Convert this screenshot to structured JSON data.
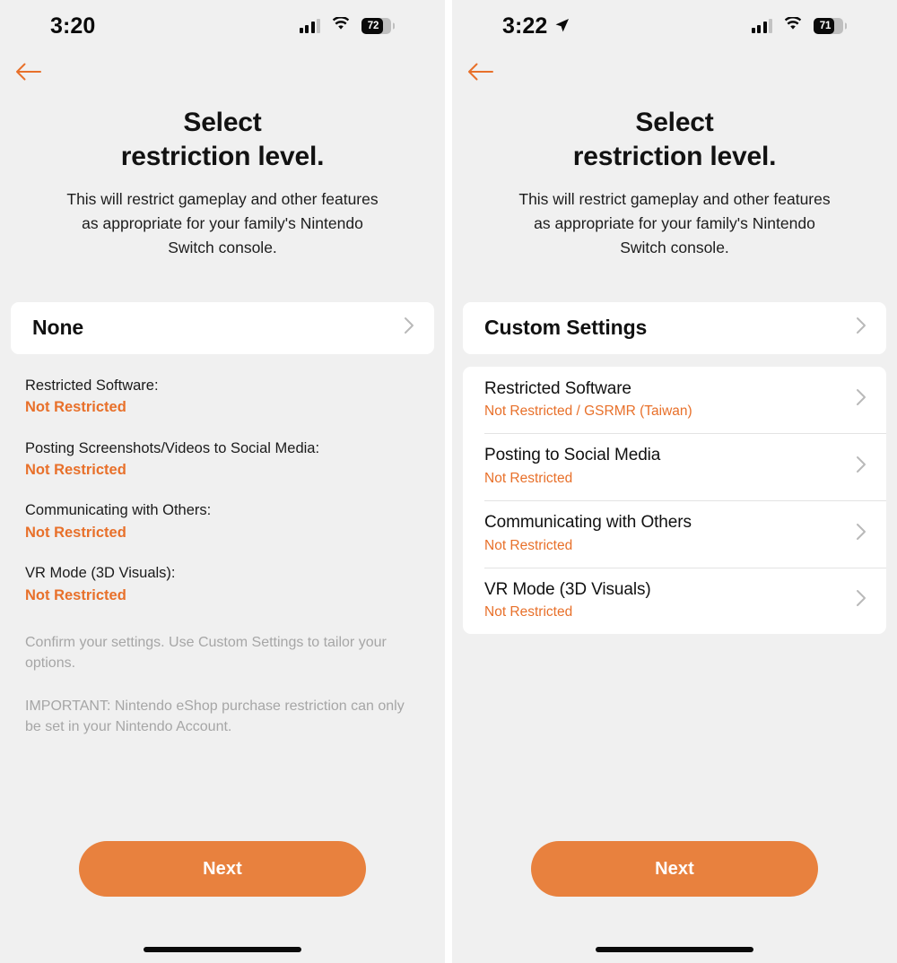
{
  "colors": {
    "accent_orange": "#e8813e",
    "value_orange": "#e8702a",
    "background": "#f0f0f0",
    "card": "#ffffff",
    "muted_text": "#a6a6a6",
    "primary_text": "#111111"
  },
  "screens": [
    {
      "name": "none-level-screen",
      "status_bar": {
        "time": "3:20",
        "location_arrow": false,
        "signal_icon": "cellular-signal-icon",
        "wifi_icon": "wifi-icon",
        "battery_icon": "battery-icon",
        "battery_level": "72"
      },
      "back_button_icon": "back-arrow-icon",
      "title_line1": "Select",
      "title_line2": "restriction level.",
      "subtitle": "This will restrict gameplay and other features as appropriate for your family's Nintendo Switch console.",
      "level_card": {
        "label": "None",
        "chevron_icon": "chevron-right-icon"
      },
      "summary_items": [
        {
          "key": "Restricted Software:",
          "value": "Not Restricted"
        },
        {
          "key": "Posting Screenshots/Videos to Social Media:",
          "value": "Not Restricted"
        },
        {
          "key": "Communicating with Others:",
          "value": "Not Restricted"
        },
        {
          "key": "VR Mode (3D Visuals):",
          "value": "Not Restricted"
        }
      ],
      "notes": [
        "Confirm your settings. Use Custom Settings to tailor your options.",
        "IMPORTANT: Nintendo eShop purchase restriction can only be set in your Nintendo Account."
      ],
      "next_button": "Next"
    },
    {
      "name": "custom-settings-screen",
      "status_bar": {
        "time": "3:22",
        "location_arrow": true,
        "signal_icon": "cellular-signal-icon",
        "wifi_icon": "wifi-icon",
        "battery_icon": "battery-icon",
        "battery_level": "71"
      },
      "back_button_icon": "back-arrow-icon",
      "title_line1": "Select",
      "title_line2": "restriction level.",
      "subtitle": "This will restrict gameplay and other features as appropriate for your family's Nintendo Switch console.",
      "level_card": {
        "label": "Custom Settings",
        "chevron_icon": "chevron-right-icon"
      },
      "settings_items": [
        {
          "key": "Restricted Software",
          "value": "Not Restricted / GSRMR (Taiwan)"
        },
        {
          "key": "Posting to Social Media",
          "value": "Not Restricted"
        },
        {
          "key": "Communicating with Others",
          "value": "Not Restricted"
        },
        {
          "key": "VR Mode (3D Visuals)",
          "value": "Not Restricted"
        }
      ],
      "next_button": "Next"
    }
  ]
}
